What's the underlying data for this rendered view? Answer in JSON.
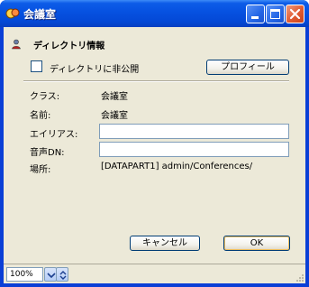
{
  "window": {
    "title": "会議室",
    "icon": "meeting-room-icon"
  },
  "section": {
    "title": "ディレクトリ情報",
    "icon": "directory-user-icon"
  },
  "hide_checkbox": {
    "label": "ディレクトリに非公開",
    "checked": false
  },
  "buttons": {
    "profile": "プロフィール",
    "cancel": "キャンセル",
    "ok": "OK"
  },
  "fields": {
    "class_label": "クラス:",
    "class_value": "会議室",
    "name_label": "名前:",
    "name_value": "会議室",
    "alias_label": "エイリアス:",
    "alias_value": "",
    "voice_dn_label": "音声DN:",
    "voice_dn_value": "",
    "location_label": "場所:",
    "location_value": "[DATAPART1] admin/Conferences/"
  },
  "status": {
    "zoom": "100%"
  },
  "colors": {
    "titlebar": "#0651e0",
    "client_bg": "#ece9d8",
    "close_button": "#e05a30"
  }
}
